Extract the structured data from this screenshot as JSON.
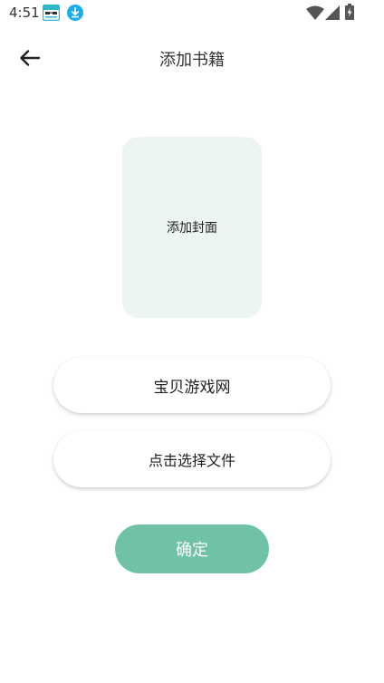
{
  "status_bar": {
    "time": "4:51",
    "icons": [
      "app-notification-icon",
      "download-icon",
      "wifi-icon",
      "signal-icon",
      "battery-charging-icon"
    ]
  },
  "header": {
    "back_icon": "arrow-left-icon",
    "title": "添加书籍"
  },
  "cover": {
    "label": "添加封面"
  },
  "form": {
    "source_value": "宝贝游戏网",
    "file_label": "点击选择文件"
  },
  "actions": {
    "confirm_label": "确定"
  },
  "colors": {
    "accent": "#6fc2a5",
    "cover_bg": "#edf5f1",
    "download_badge": "#1aaef0",
    "app_icon": "#2bb8c8"
  }
}
